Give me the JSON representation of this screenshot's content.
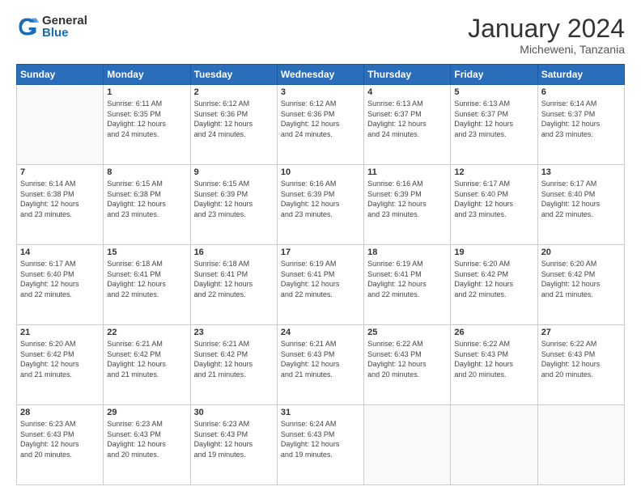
{
  "logo": {
    "general": "General",
    "blue": "Blue"
  },
  "header": {
    "month": "January 2024",
    "location": "Micheweni, Tanzania"
  },
  "weekdays": [
    "Sunday",
    "Monday",
    "Tuesday",
    "Wednesday",
    "Thursday",
    "Friday",
    "Saturday"
  ],
  "weeks": [
    [
      {
        "day": "",
        "info": ""
      },
      {
        "day": "1",
        "info": "Sunrise: 6:11 AM\nSunset: 6:35 PM\nDaylight: 12 hours\nand 24 minutes."
      },
      {
        "day": "2",
        "info": "Sunrise: 6:12 AM\nSunset: 6:36 PM\nDaylight: 12 hours\nand 24 minutes."
      },
      {
        "day": "3",
        "info": "Sunrise: 6:12 AM\nSunset: 6:36 PM\nDaylight: 12 hours\nand 24 minutes."
      },
      {
        "day": "4",
        "info": "Sunrise: 6:13 AM\nSunset: 6:37 PM\nDaylight: 12 hours\nand 24 minutes."
      },
      {
        "day": "5",
        "info": "Sunrise: 6:13 AM\nSunset: 6:37 PM\nDaylight: 12 hours\nand 23 minutes."
      },
      {
        "day": "6",
        "info": "Sunrise: 6:14 AM\nSunset: 6:37 PM\nDaylight: 12 hours\nand 23 minutes."
      }
    ],
    [
      {
        "day": "7",
        "info": "Sunrise: 6:14 AM\nSunset: 6:38 PM\nDaylight: 12 hours\nand 23 minutes."
      },
      {
        "day": "8",
        "info": "Sunrise: 6:15 AM\nSunset: 6:38 PM\nDaylight: 12 hours\nand 23 minutes."
      },
      {
        "day": "9",
        "info": "Sunrise: 6:15 AM\nSunset: 6:39 PM\nDaylight: 12 hours\nand 23 minutes."
      },
      {
        "day": "10",
        "info": "Sunrise: 6:16 AM\nSunset: 6:39 PM\nDaylight: 12 hours\nand 23 minutes."
      },
      {
        "day": "11",
        "info": "Sunrise: 6:16 AM\nSunset: 6:39 PM\nDaylight: 12 hours\nand 23 minutes."
      },
      {
        "day": "12",
        "info": "Sunrise: 6:17 AM\nSunset: 6:40 PM\nDaylight: 12 hours\nand 23 minutes."
      },
      {
        "day": "13",
        "info": "Sunrise: 6:17 AM\nSunset: 6:40 PM\nDaylight: 12 hours\nand 22 minutes."
      }
    ],
    [
      {
        "day": "14",
        "info": "Sunrise: 6:17 AM\nSunset: 6:40 PM\nDaylight: 12 hours\nand 22 minutes."
      },
      {
        "day": "15",
        "info": "Sunrise: 6:18 AM\nSunset: 6:41 PM\nDaylight: 12 hours\nand 22 minutes."
      },
      {
        "day": "16",
        "info": "Sunrise: 6:18 AM\nSunset: 6:41 PM\nDaylight: 12 hours\nand 22 minutes."
      },
      {
        "day": "17",
        "info": "Sunrise: 6:19 AM\nSunset: 6:41 PM\nDaylight: 12 hours\nand 22 minutes."
      },
      {
        "day": "18",
        "info": "Sunrise: 6:19 AM\nSunset: 6:41 PM\nDaylight: 12 hours\nand 22 minutes."
      },
      {
        "day": "19",
        "info": "Sunrise: 6:20 AM\nSunset: 6:42 PM\nDaylight: 12 hours\nand 22 minutes."
      },
      {
        "day": "20",
        "info": "Sunrise: 6:20 AM\nSunset: 6:42 PM\nDaylight: 12 hours\nand 21 minutes."
      }
    ],
    [
      {
        "day": "21",
        "info": "Sunrise: 6:20 AM\nSunset: 6:42 PM\nDaylight: 12 hours\nand 21 minutes."
      },
      {
        "day": "22",
        "info": "Sunrise: 6:21 AM\nSunset: 6:42 PM\nDaylight: 12 hours\nand 21 minutes."
      },
      {
        "day": "23",
        "info": "Sunrise: 6:21 AM\nSunset: 6:42 PM\nDaylight: 12 hours\nand 21 minutes."
      },
      {
        "day": "24",
        "info": "Sunrise: 6:21 AM\nSunset: 6:43 PM\nDaylight: 12 hours\nand 21 minutes."
      },
      {
        "day": "25",
        "info": "Sunrise: 6:22 AM\nSunset: 6:43 PM\nDaylight: 12 hours\nand 20 minutes."
      },
      {
        "day": "26",
        "info": "Sunrise: 6:22 AM\nSunset: 6:43 PM\nDaylight: 12 hours\nand 20 minutes."
      },
      {
        "day": "27",
        "info": "Sunrise: 6:22 AM\nSunset: 6:43 PM\nDaylight: 12 hours\nand 20 minutes."
      }
    ],
    [
      {
        "day": "28",
        "info": "Sunrise: 6:23 AM\nSunset: 6:43 PM\nDaylight: 12 hours\nand 20 minutes."
      },
      {
        "day": "29",
        "info": "Sunrise: 6:23 AM\nSunset: 6:43 PM\nDaylight: 12 hours\nand 20 minutes."
      },
      {
        "day": "30",
        "info": "Sunrise: 6:23 AM\nSunset: 6:43 PM\nDaylight: 12 hours\nand 19 minutes."
      },
      {
        "day": "31",
        "info": "Sunrise: 6:24 AM\nSunset: 6:43 PM\nDaylight: 12 hours\nand 19 minutes."
      },
      {
        "day": "",
        "info": ""
      },
      {
        "day": "",
        "info": ""
      },
      {
        "day": "",
        "info": ""
      }
    ]
  ]
}
